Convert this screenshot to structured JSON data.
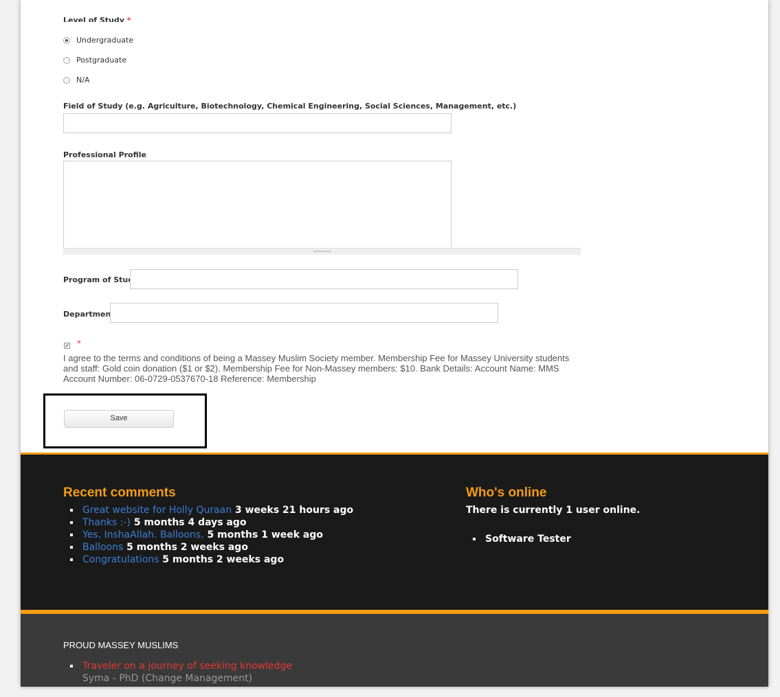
{
  "form": {
    "level_label": "Level of Study",
    "required_mark": "*",
    "levels": [
      {
        "label": "Undergraduate",
        "selected": true
      },
      {
        "label": "Postgraduate",
        "selected": false
      },
      {
        "label": "N/A",
        "selected": false
      }
    ],
    "field_of_study_label": "Field of Study (e.g. Agriculture, Biotechnology, Chemical Engineering, Social Sciences, Management, etc.)",
    "field_of_study_value": "",
    "profile_label": "Professional Profile",
    "profile_value": "",
    "program_label": "Program of Study",
    "program_value": "",
    "department_label": "Department",
    "department_value": "",
    "terms_checked": true,
    "terms_text": "I agree to the terms and conditions of being a Massey Muslim Society member. Membership Fee for Massey University students and staff: Gold coin donation ($1 or $2). Membership Fee for Non-Massey members: $10. Bank Details: Account Name: MMS Account Number: 06-0729-0537670-18 Reference: Membership",
    "save_label": "Save"
  },
  "footer": {
    "recent_comments_title": "Recent comments",
    "comments": [
      {
        "link": "Great website for Holly Quraan",
        "time": "3 weeks 21 hours ago"
      },
      {
        "link": "Thanks :-)",
        "time": "5 months 4 days ago"
      },
      {
        "link": "Yes, InshaAllah. Balloons,",
        "time": "5 months 1 week ago"
      },
      {
        "link": "Balloons",
        "time": "5 months 2 weeks ago"
      },
      {
        "link": "Congratulations",
        "time": "5 months 2 weeks ago"
      }
    ],
    "whos_online_title": "Who's online",
    "online_text": "There is currently 1 user online.",
    "online_users": [
      "Software Tester"
    ],
    "proud_title": "PROUD MASSEY MUSLIMS",
    "proud_items": [
      {
        "quote": "Traveler on a journey of seeking knowledge",
        "author": "Syma - PhD (Change Management)"
      }
    ]
  },
  "colors": {
    "accent": "#f39c12",
    "link": "#3d7fd6",
    "required": "#e53935",
    "quote": "#e53935"
  }
}
